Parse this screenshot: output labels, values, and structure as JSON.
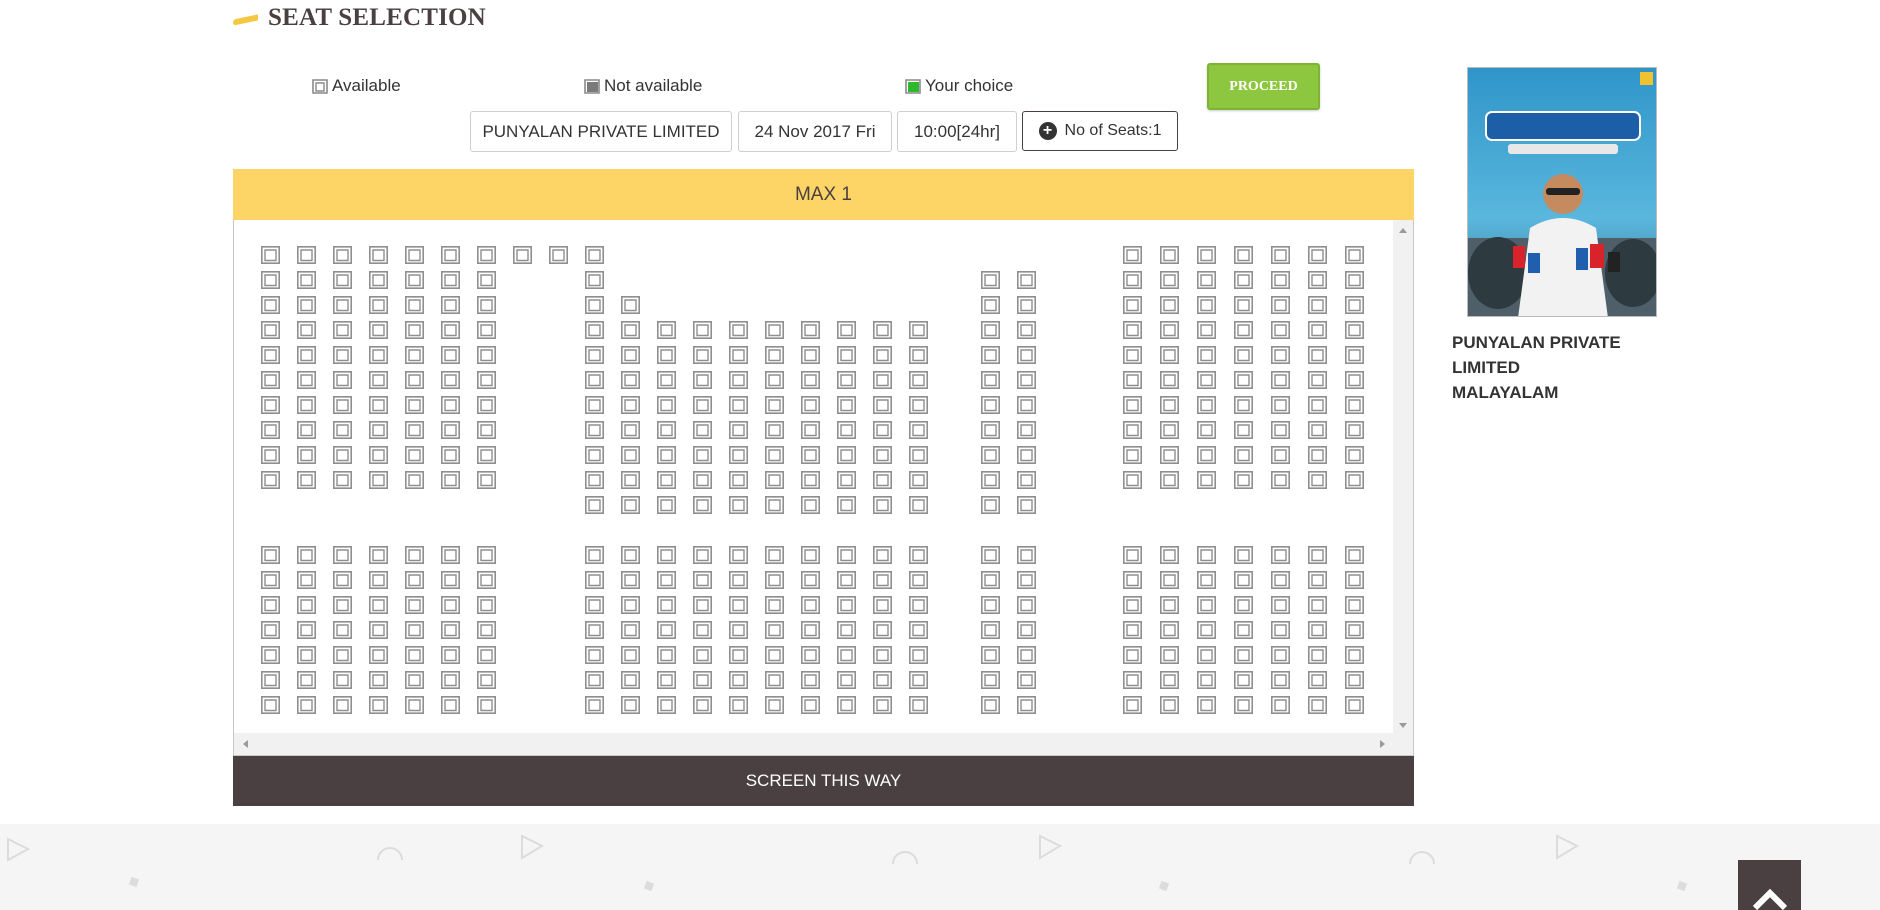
{
  "page": {
    "title": "SEAT SELECTION"
  },
  "legend": {
    "available": "Available",
    "not_available": "Not available",
    "your_choice": "Your choice"
  },
  "actions": {
    "proceed": "PROCEED",
    "no_of_seats": "No of Seats:1"
  },
  "show": {
    "movie": "PUNYALAN PRIVATE LIMITED",
    "date": "24 Nov 2017 Fri",
    "time": "10:00[24hr]"
  },
  "seat_map": {
    "max_label": "MAX 1",
    "screen_label": "SCREEN THIS WAY"
  },
  "movie_info": {
    "name_line1": "PUNYALAN PRIVATE",
    "name_line2": "LIMITED",
    "language": "MALAYALAM"
  },
  "footer": {
    "heading": ""
  },
  "colors": {
    "accent_yellow": "#fdd567",
    "proceed_green": "#8dc63f",
    "dark": "#4a4041",
    "choice_green": "#2db82d",
    "unavailable_gray": "#8a8a8a"
  },
  "icons": {
    "scroll_top": "chevron-up-icon",
    "plus": "plus-circle-icon",
    "seat": "seat-icon"
  }
}
